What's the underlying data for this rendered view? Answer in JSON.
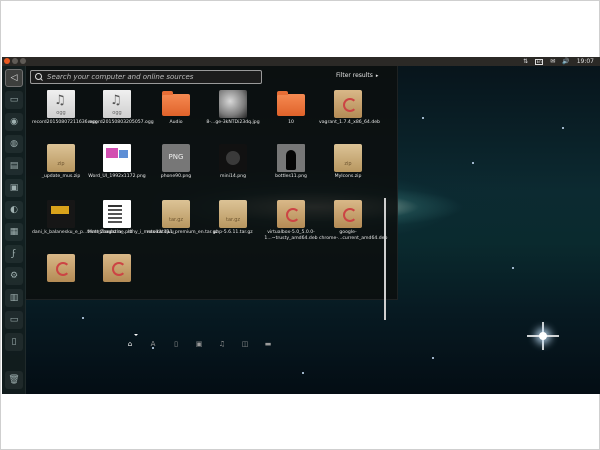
{
  "topbar": {
    "indicators": [
      "⇅",
      "En",
      "✉",
      "🔊",
      "19:07"
    ]
  },
  "launcher": {
    "items": [
      {
        "name": "dash-home-button"
      },
      {
        "name": "files-button"
      },
      {
        "name": "browser-button"
      },
      {
        "name": "mail-button"
      },
      {
        "name": "office-button"
      },
      {
        "name": "media-button"
      },
      {
        "name": "terminal-button"
      },
      {
        "name": "software-button"
      },
      {
        "name": "settings-button"
      },
      {
        "name": "workspace-button"
      },
      {
        "name": "trash-button"
      }
    ]
  },
  "dash": {
    "search_placeholder": "Search your computer and online sources",
    "filter_label": "Filter results",
    "items": [
      {
        "label": "record20150807211636.ogg",
        "icon": "audio-file-icon"
      },
      {
        "label": "record20150803205057.ogg",
        "icon": "audio-file-icon"
      },
      {
        "label": "Audio",
        "icon": "folder-icon"
      },
      {
        "label": "8-...ge-3kNTDi23dq.jpg",
        "icon": "image-moon-icon"
      },
      {
        "label": "10",
        "icon": "folder-icon"
      },
      {
        "label": "vagrant_1.7.4_x86_64.deb",
        "icon": "package-icon"
      },
      {
        "label": "_update_mus.zip",
        "icon": "zip-icon"
      },
      {
        "label": "Word_UI_1992x1172.png",
        "icon": "image-word-icon"
      },
      {
        "label": "phone90.png",
        "icon": "png-icon"
      },
      {
        "label": "mini14.png",
        "icon": "image-dark-icon"
      },
      {
        "label": "bottles11.png",
        "icon": "image-bottles-icon"
      },
      {
        "label": "MyIcons.zip",
        "icon": "zip-icon"
      },
      {
        "label": "dani_k_balanesku_e_p...ternetmagazine.pdf",
        "icon": "pdf-icon"
      },
      {
        "label": "Matt_Zandstra_...lony_i_metodik.djvu",
        "icon": "djvu-icon"
      },
      {
        "label": "navicat111_premium_en.tar.gz",
        "icon": "targz-icon"
      },
      {
        "label": "php-5.6.11.tar.gz",
        "icon": "targz-icon"
      },
      {
        "label": "virtualbox-5.0_5.0.0-1...~trusty_amd64.deb",
        "icon": "package-icon"
      },
      {
        "label": "google-chrome-...current_amd64.deb",
        "icon": "package-icon"
      },
      {
        "label": "",
        "icon": "package-icon"
      },
      {
        "label": "",
        "icon": "package-icon"
      }
    ]
  },
  "lenses": [
    "home",
    "applications",
    "files",
    "video",
    "music",
    "photos",
    "social"
  ]
}
